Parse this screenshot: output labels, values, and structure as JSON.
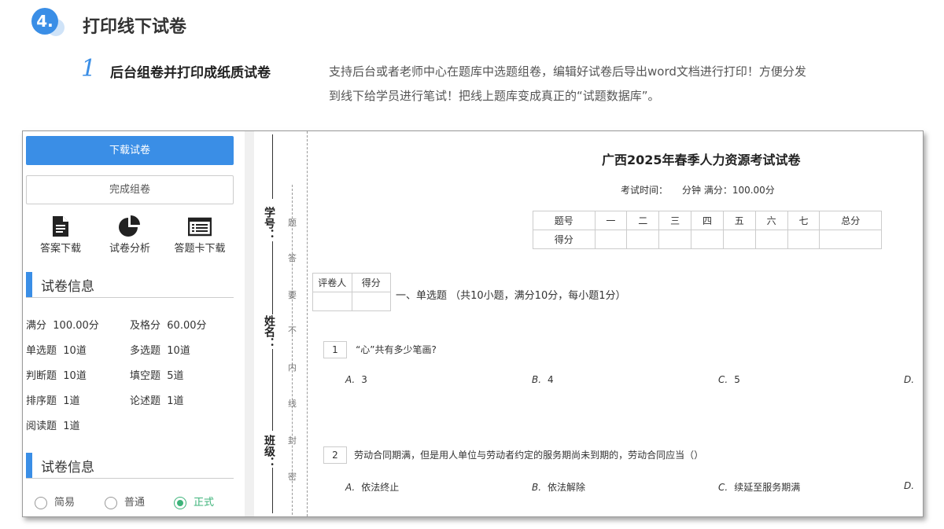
{
  "header": {
    "number": "4.",
    "title": "打印线下试卷",
    "step_number": "1",
    "step_title": "后台组卷并打印成纸质试卷",
    "step_desc_line1": "支持后台或者老师中心在题库中选题组卷，编辑好试卷后导出word文档进行打印！方便分发",
    "step_desc_line2": "到线下给学员进行笔试！把线上题库变成真正的“试题数据库”。"
  },
  "sidebar": {
    "download_button": "下载试卷",
    "finish_button": "完成组卷",
    "tools": [
      {
        "label": "答案下载",
        "icon": "document-icon"
      },
      {
        "label": "试卷分析",
        "icon": "pie-chart-icon"
      },
      {
        "label": "答题卡下载",
        "icon": "list-card-icon"
      }
    ],
    "info_heading": "试卷信息",
    "info": [
      {
        "label": "满分",
        "value": "100.00分"
      },
      {
        "label": "及格分",
        "value": "60.00分"
      },
      {
        "label": "单选题",
        "value": "10道"
      },
      {
        "label": "多选题",
        "value": "10道"
      },
      {
        "label": "判断题",
        "value": "10道"
      },
      {
        "label": "填空题",
        "value": "5道"
      },
      {
        "label": "排序题",
        "value": "1道"
      },
      {
        "label": "论述题",
        "value": "1道"
      },
      {
        "label": "阅读题",
        "value": "1道"
      }
    ],
    "type_heading": "试卷信息",
    "types": [
      {
        "label": "简易",
        "selected": false
      },
      {
        "label": "普通",
        "selected": false
      },
      {
        "label": "正式",
        "selected": true
      }
    ]
  },
  "binding": {
    "student_id": "学号：",
    "name": "姓名：",
    "class": "班级：",
    "seal_chars": [
      "题",
      "答",
      "要",
      "不",
      "内",
      "线",
      "封",
      "密"
    ]
  },
  "paper": {
    "title": "广西2025年春季人力资源考试试卷",
    "subtitle": "考试时间：　　分钟 满分：100.00分",
    "score_table": {
      "header": [
        "题号",
        "一",
        "二",
        "三",
        "四",
        "五",
        "六",
        "七",
        "总分"
      ],
      "row_label": "得分"
    },
    "grader_table": [
      "评卷人",
      "得分"
    ],
    "section_heading": "一、单选题 （共10小题，满分10分，每小题1分）",
    "questions": [
      {
        "number": "1",
        "text": "“心”共有多少笔画?",
        "options": [
          {
            "letter": "A.",
            "text": "3"
          },
          {
            "letter": "B.",
            "text": "4"
          },
          {
            "letter": "C.",
            "text": "5"
          },
          {
            "letter": "D.",
            "text": ""
          }
        ]
      },
      {
        "number": "2",
        "text": "劳动合同期满，但是用人单位与劳动者约定的服务期尚未到期的，劳动合同应当（）",
        "options": [
          {
            "letter": "A.",
            "text": "依法终止"
          },
          {
            "letter": "B.",
            "text": "依法解除"
          },
          {
            "letter": "C.",
            "text": "续延至服务期满"
          },
          {
            "letter": "D.",
            "text": ""
          }
        ]
      }
    ]
  },
  "colors": {
    "accent": "#3a8ee6",
    "selected_radio": "#3db37a"
  }
}
